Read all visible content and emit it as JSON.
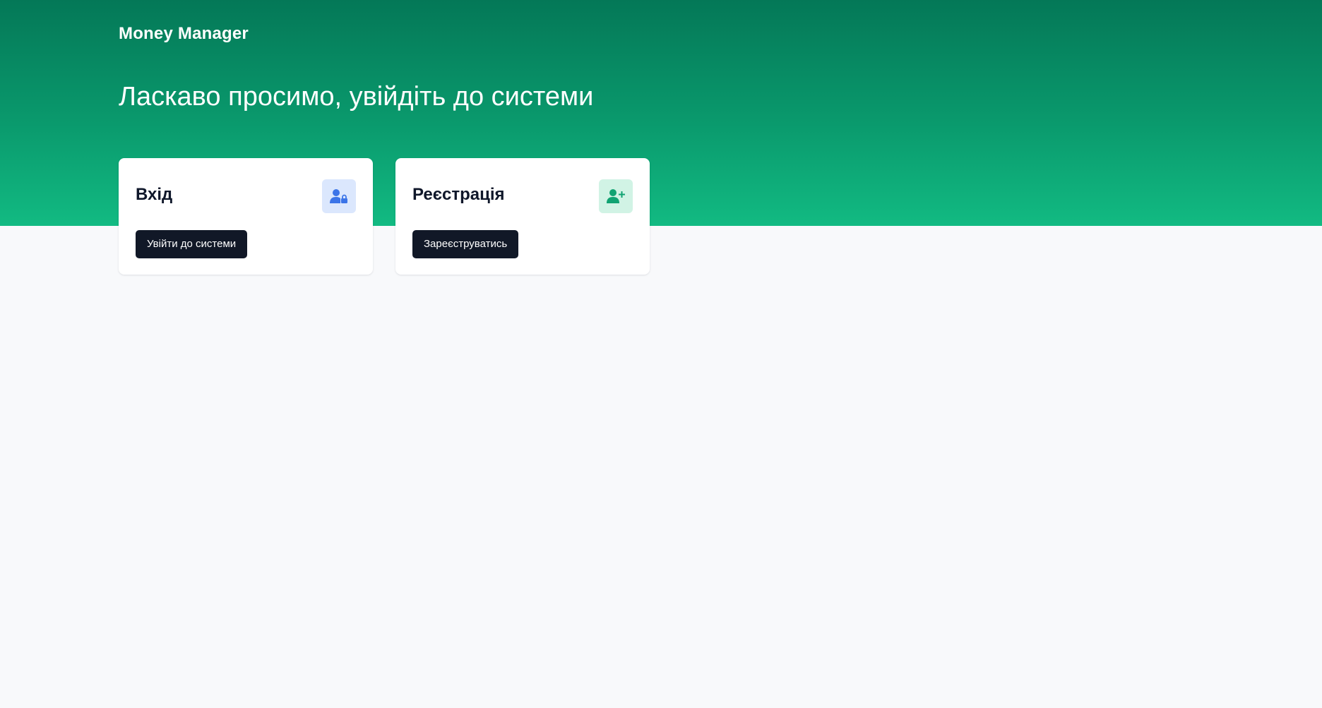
{
  "app": {
    "brand": "Money Manager"
  },
  "hero": {
    "headline": "Ласкаво просимо, увійдіть до системи"
  },
  "cards": {
    "login": {
      "title": "Вхід",
      "icon": "user-lock-icon",
      "button_label": "Увійти до системи"
    },
    "register": {
      "title": "Реєстрація",
      "icon": "user-plus-icon",
      "button_label": "Зареєструватись"
    }
  },
  "colors": {
    "hero_gradient_top": "#047857",
    "hero_gradient_bottom": "#12ba82",
    "page_background": "#f8f9fb",
    "button_background": "#111827",
    "login_icon_bg": "#dbe7fd",
    "login_icon_fg": "#3b74e8",
    "register_icon_bg": "#d1f3e5",
    "register_icon_fg": "#10a372"
  }
}
